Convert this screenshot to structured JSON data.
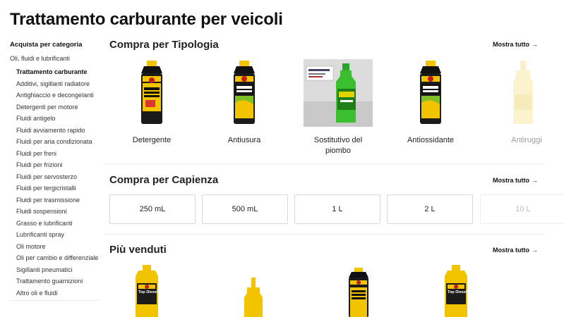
{
  "page": {
    "title": "Trattamento carburante per veicoli"
  },
  "sidebar": {
    "heading": "Acquista per categoria",
    "parent": "Oli, fluidi e lubrificanti",
    "items": [
      {
        "label": "Trattamento carburante",
        "active": true
      },
      {
        "label": "Additivi, sigillanti radiatore"
      },
      {
        "label": "Antighiaccio e decongelanti"
      },
      {
        "label": "Detergenti per motore"
      },
      {
        "label": "Fluidi antigelo"
      },
      {
        "label": "Fluidi avviamento rapido"
      },
      {
        "label": "Fluidi per aria condizionata"
      },
      {
        "label": "Fluidi per freni"
      },
      {
        "label": "Fluidi per frizioni"
      },
      {
        "label": "Fluidi per servosterzo"
      },
      {
        "label": "Fluidi per tergicristalli"
      },
      {
        "label": "Fluidi per trasmissione"
      },
      {
        "label": "Fluidi sospensioni"
      },
      {
        "label": "Grasso e lubrificanti"
      },
      {
        "label": "Lubrificanti spray"
      },
      {
        "label": "Oli motore"
      },
      {
        "label": "Oli per cambio e differenziale"
      },
      {
        "label": "Sigillanti pneumatici"
      },
      {
        "label": "Trattamento guarnizioni"
      },
      {
        "label": "Altro oli e fluidi"
      }
    ]
  },
  "sections": {
    "by_type": {
      "title": "Compra per Tipologia",
      "see_all": "Mostra tutto",
      "items": [
        {
          "label": "Detergente",
          "image": "bardahl-black-can"
        },
        {
          "label": "Antiusura",
          "image": "bardahl-water-remover-can"
        },
        {
          "label": "Sostitutivo del piombo",
          "image": "green-bottle-photo"
        },
        {
          "label": "Antiossidante",
          "image": "bardahl-water-remover-can"
        },
        {
          "label": "Antiruggi",
          "image": "pale-yellow-bottle"
        }
      ]
    },
    "by_capacity": {
      "title": "Compra per Capienza",
      "see_all": "Mostra tutto",
      "items": [
        "250 mL",
        "500 mL",
        "1 L",
        "2 L",
        "10 L"
      ]
    },
    "best_sellers": {
      "title": "Più venduti",
      "see_all": "Mostra tutto",
      "products": [
        {
          "image": "bardahl-top-diesel-bottle",
          "label_text": "Top Diesel"
        },
        {
          "image": "yellow-bottle"
        },
        {
          "image": "bardahl-injector-cleaner-can"
        },
        {
          "image": "bardahl-top-diesel-bottle",
          "label_text": "Top Diesel"
        }
      ]
    }
  },
  "colors": {
    "bardahl_yellow": "#f2c400",
    "bardahl_black": "#1b1b1b",
    "green_bottle": "#3bbf2e"
  }
}
